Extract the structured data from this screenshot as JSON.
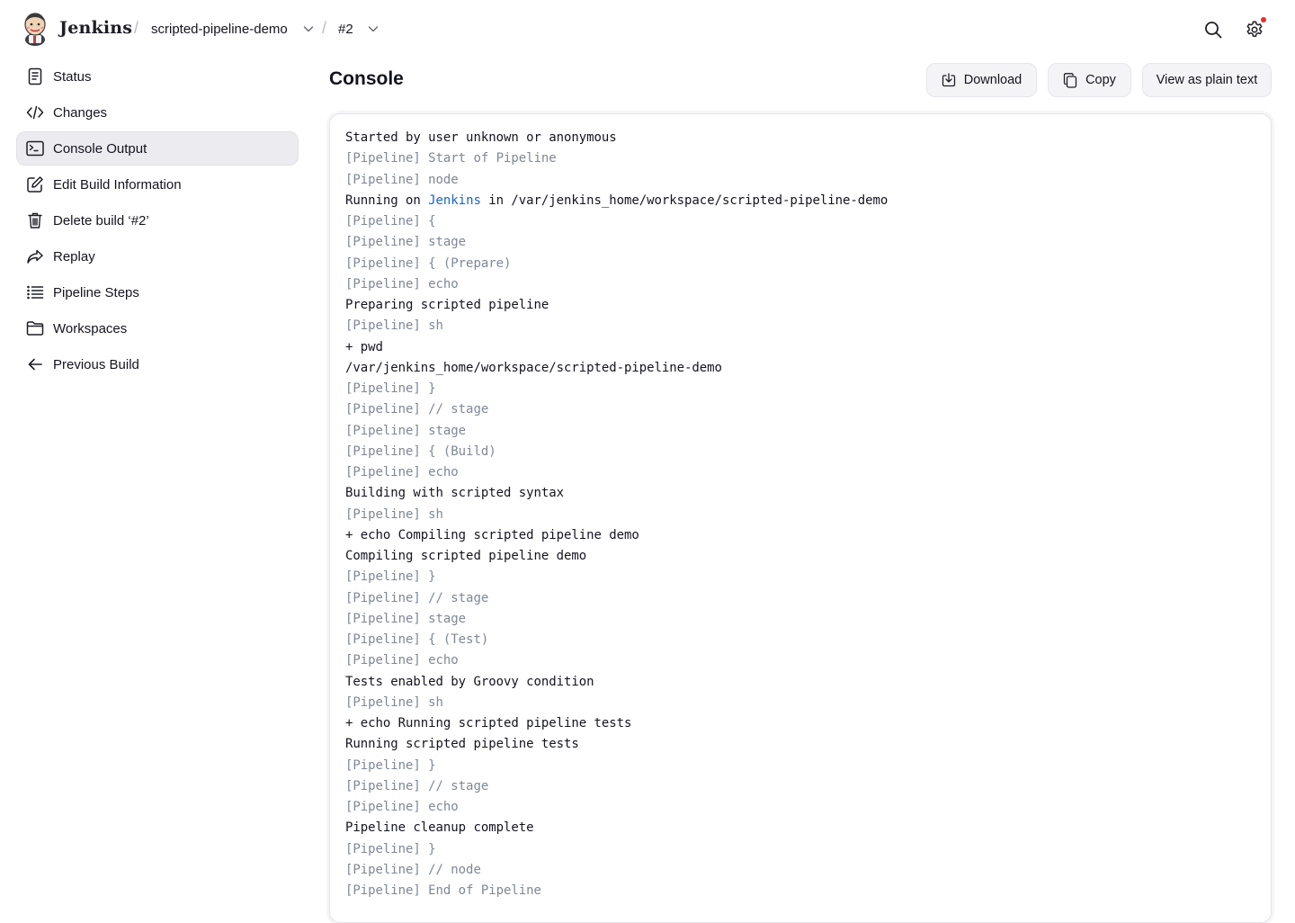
{
  "header": {
    "brand": "Jenkins",
    "breadcrumbs": [
      {
        "label": "scripted-pipeline-demo"
      },
      {
        "label": "#2"
      }
    ],
    "separator": "/",
    "icons": {
      "search": "search-icon",
      "settings": "gear-icon",
      "notification_color": "#e62e2e"
    }
  },
  "sidebar": {
    "items": [
      {
        "label": "Status",
        "icon": "document-icon",
        "active": false
      },
      {
        "label": "Changes",
        "icon": "code-icon",
        "active": false
      },
      {
        "label": "Console Output",
        "icon": "terminal-icon",
        "active": true
      },
      {
        "label": "Edit Build Information",
        "icon": "edit-icon",
        "active": false
      },
      {
        "label": "Delete build ‘#2’",
        "icon": "trash-icon",
        "active": false
      },
      {
        "label": "Replay",
        "icon": "replay-icon",
        "active": false
      },
      {
        "label": "Pipeline Steps",
        "icon": "list-icon",
        "active": false
      },
      {
        "label": "Workspaces",
        "icon": "folder-icon",
        "active": false
      },
      {
        "label": "Previous Build",
        "icon": "arrow-left-icon",
        "active": false
      }
    ]
  },
  "main": {
    "title": "Console",
    "actions": {
      "download": "Download",
      "copy": "Copy",
      "plain_text": "View as plain text"
    },
    "console": {
      "link_color": "#1663d6",
      "pipeline_color": "#7f8896",
      "lines": [
        {
          "text": "Started by user unknown or anonymous",
          "kind": "out"
        },
        {
          "text": "[Pipeline] Start of Pipeline",
          "kind": "pl"
        },
        {
          "text": "[Pipeline] node",
          "kind": "pl"
        },
        {
          "kind": "link",
          "before": "Running on ",
          "link": "Jenkins",
          "after": " in /var/jenkins_home/workspace/scripted-pipeline-demo"
        },
        {
          "text": "[Pipeline] {",
          "kind": "pl"
        },
        {
          "text": "[Pipeline] stage",
          "kind": "pl"
        },
        {
          "text": "[Pipeline] { (Prepare)",
          "kind": "pl"
        },
        {
          "text": "[Pipeline] echo",
          "kind": "pl"
        },
        {
          "text": "Preparing scripted pipeline",
          "kind": "out"
        },
        {
          "text": "[Pipeline] sh",
          "kind": "pl"
        },
        {
          "text": "+ pwd",
          "kind": "out"
        },
        {
          "text": "/var/jenkins_home/workspace/scripted-pipeline-demo",
          "kind": "out"
        },
        {
          "text": "[Pipeline] }",
          "kind": "pl"
        },
        {
          "text": "[Pipeline] // stage",
          "kind": "pl"
        },
        {
          "text": "[Pipeline] stage",
          "kind": "pl"
        },
        {
          "text": "[Pipeline] { (Build)",
          "kind": "pl"
        },
        {
          "text": "[Pipeline] echo",
          "kind": "pl"
        },
        {
          "text": "Building with scripted syntax",
          "kind": "out"
        },
        {
          "text": "[Pipeline] sh",
          "kind": "pl"
        },
        {
          "text": "+ echo Compiling scripted pipeline demo",
          "kind": "out"
        },
        {
          "text": "Compiling scripted pipeline demo",
          "kind": "out"
        },
        {
          "text": "[Pipeline] }",
          "kind": "pl"
        },
        {
          "text": "[Pipeline] // stage",
          "kind": "pl"
        },
        {
          "text": "[Pipeline] stage",
          "kind": "pl"
        },
        {
          "text": "[Pipeline] { (Test)",
          "kind": "pl"
        },
        {
          "text": "[Pipeline] echo",
          "kind": "pl"
        },
        {
          "text": "Tests enabled by Groovy condition",
          "kind": "out"
        },
        {
          "text": "[Pipeline] sh",
          "kind": "pl"
        },
        {
          "text": "+ echo Running scripted pipeline tests",
          "kind": "out"
        },
        {
          "text": "Running scripted pipeline tests",
          "kind": "out"
        },
        {
          "text": "[Pipeline] }",
          "kind": "pl"
        },
        {
          "text": "[Pipeline] // stage",
          "kind": "pl"
        },
        {
          "text": "[Pipeline] echo",
          "kind": "pl"
        },
        {
          "text": "Pipeline cleanup complete",
          "kind": "out"
        },
        {
          "text": "[Pipeline] }",
          "kind": "pl"
        },
        {
          "text": "[Pipeline] // node",
          "kind": "pl"
        },
        {
          "text": "[Pipeline] End of Pipeline",
          "kind": "pl"
        }
      ]
    }
  }
}
